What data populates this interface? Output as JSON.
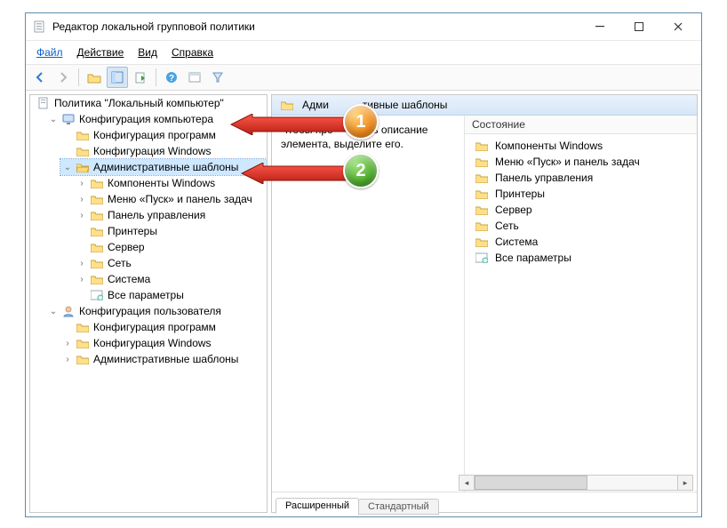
{
  "window": {
    "title": "Редактор локальной групповой политики"
  },
  "menu": {
    "file": "Файл",
    "action": "Действие",
    "view": "Вид",
    "help": "Справка"
  },
  "tree": {
    "root": "Политика \"Локальный компьютер\"",
    "comp": "Конфигурация компьютера",
    "comp_soft": "Конфигурация программ",
    "comp_win": "Конфигурация Windows",
    "comp_adm": "Административные шаблоны",
    "adm_winc": "Компоненты Windows",
    "adm_start": "Меню «Пуск» и панель задач",
    "adm_cpl": "Панель управления",
    "adm_print": "Принтеры",
    "adm_server": "Сервер",
    "adm_net": "Сеть",
    "adm_sys": "Система",
    "adm_all": "Все параметры",
    "user": "Конфигурация пользователя",
    "user_soft": "Конфигурация программ",
    "user_win": "Конфигурация Windows",
    "user_adm": "Административные шаблоны"
  },
  "content": {
    "header": "Административные шаблоны",
    "header_masked_left": "Адми",
    "header_masked_right": "тивные шаблоны",
    "hint_masked_left": "Чтобы про",
    "hint_masked_right": "еть описание элемента, выделите его.",
    "col_state": "Состояние",
    "items": {
      "winc": "Компоненты Windows",
      "start": "Меню «Пуск» и панель задач",
      "cpl": "Панель управления",
      "print": "Принтеры",
      "server": "Сервер",
      "net": "Сеть",
      "sys": "Система",
      "all": "Все параметры"
    }
  },
  "tabs": {
    "extended": "Расширенный",
    "standard": "Стандартный"
  },
  "callouts": {
    "one": "1",
    "two": "2"
  }
}
